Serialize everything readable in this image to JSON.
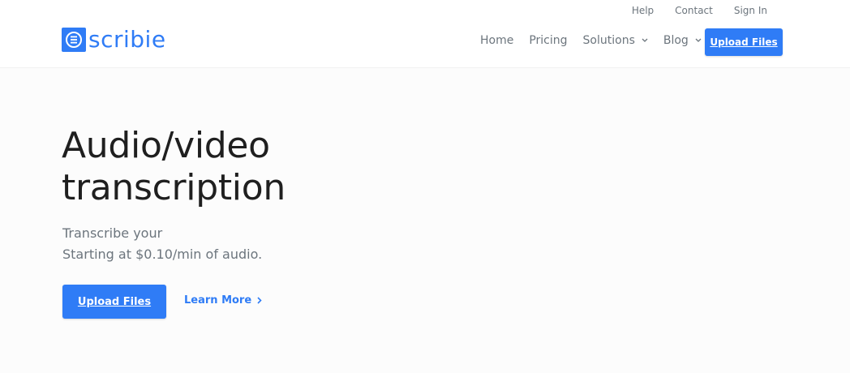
{
  "brand": {
    "name": "scribie",
    "color": "#2f7cf6"
  },
  "topbar": {
    "links": [
      "Help",
      "Contact",
      "Sign In"
    ]
  },
  "nav": {
    "home": "Home",
    "pricing": "Pricing",
    "solutions": "Solutions",
    "blog": "Blog",
    "upload": "Upload Files"
  },
  "hero": {
    "title_line1": "Audio/video",
    "title_line2": "transcription",
    "sub_line1": "Transcribe your",
    "sub_line2": "Starting at $0.10/min of audio.",
    "upload": "Upload Files",
    "learn_more": "Learn More"
  },
  "icons": {
    "logo": "scribie-logo-icon",
    "chevron": "chevron-down-icon",
    "arrow": "chevron-right-icon"
  }
}
